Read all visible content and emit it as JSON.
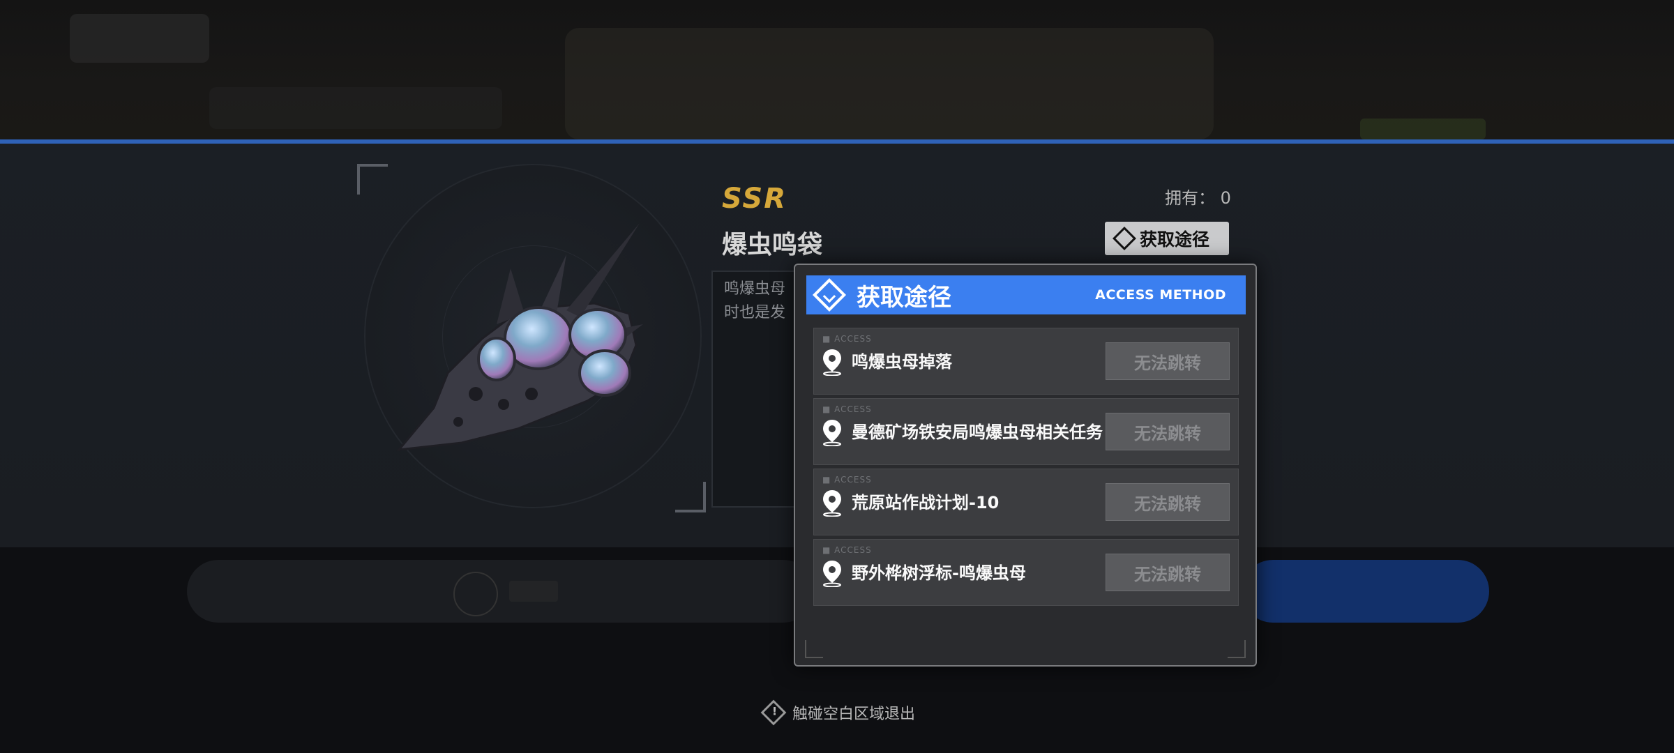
{
  "item": {
    "rarity": "SSR",
    "name": "爆虫鸣袋",
    "owned": "拥有： 0",
    "description": "鸣爆虫母 时也是发",
    "access_button": "获取途径"
  },
  "modal": {
    "title": "获取途径",
    "subtitle": "ACCESS METHOD",
    "rows": [
      {
        "tag": "■ ACCESS",
        "label": "鸣爆虫母掉落",
        "button": "无法跳转"
      },
      {
        "tag": "■ ACCESS",
        "label": "曼德矿场铁安局鸣爆虫母相关任务",
        "button": "无法跳转"
      },
      {
        "tag": "■ ACCESS",
        "label": "荒原站作战计划-10",
        "button": "无法跳转"
      },
      {
        "tag": "■ ACCESS",
        "label": "野外桦树浮标-鸣爆虫母",
        "button": "无法跳转"
      }
    ]
  },
  "footer": {
    "exit_hint": "触碰空白区域退出"
  },
  "colors": {
    "accent_blue": "#3b7ff0",
    "rarity_gold": "#d6a83a",
    "band_line": "#2f62b8"
  }
}
